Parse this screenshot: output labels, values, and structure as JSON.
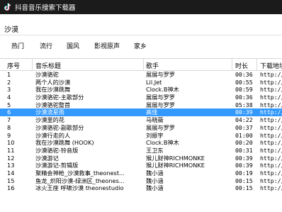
{
  "window": {
    "title": "抖音音乐搜索下载器"
  },
  "search": {
    "value": "沙漠"
  },
  "tabs": [
    "热门",
    "流行",
    "国风",
    "影视原声",
    "家乡"
  ],
  "table": {
    "headers": {
      "index": "序号",
      "title": "音乐标题",
      "artist": "歌手",
      "duration": "时长",
      "download": "下载地址"
    },
    "rows": [
      {
        "index": "1",
        "title": "沙漠骆驼",
        "artist": "展展与罗罗",
        "duration": "00:36",
        "download": "http://p"
      },
      {
        "index": "2",
        "title": "两个人的沙漠",
        "artist": "Lil.Jet",
        "duration": "00:55",
        "download": "http://p"
      },
      {
        "index": "3",
        "title": "我在沙漠跳舞",
        "artist": "Clock.B神木",
        "duration": "00:59",
        "download": "http://p"
      },
      {
        "index": "4",
        "title": "沙漠骆驼-主歌部分",
        "artist": "展展与罗罗",
        "duration": "00:36",
        "download": "http://p"
      },
      {
        "index": "5",
        "title": "沙漠骆驼整首",
        "artist": "展展与罗罗",
        "duration": "05:38",
        "download": "http://p"
      },
      {
        "index": "6",
        "title": "沙漠流星雨",
        "artist": "高佳",
        "duration": "00:39",
        "download": "http://p"
      },
      {
        "index": "7",
        "title": "沙漠里的花",
        "artist": "马晓薇",
        "duration": "04:22",
        "download": "http://p"
      },
      {
        "index": "8",
        "title": "沙漠骆驼-副歌部分",
        "artist": "展展与罗罗",
        "duration": "00:37",
        "download": "http://p"
      },
      {
        "index": "9",
        "title": "沙漠行走的人",
        "artist": "刘振宇",
        "duration": "01:00",
        "download": "http://p"
      },
      {
        "index": "10",
        "title": "我在沙漠跳舞 (HOOK)",
        "artist": "Clock.B神木",
        "duration": "00:20",
        "download": "http://p"
      },
      {
        "index": "11",
        "title": "沙漠骆驼-铃音版",
        "artist": "王卫东",
        "duration": "00:31",
        "download": "http://p"
      },
      {
        "index": "12",
        "title": "沙漠游记",
        "artist": "猴儿财神RICHMONKE",
        "duration": "00:39",
        "download": "http://p"
      },
      {
        "index": "13",
        "title": "沙漠游记-剪辑版",
        "artist": "猴儿财神RICHMONKE",
        "duration": "00:39",
        "download": "http://p"
      },
      {
        "index": "14",
        "title": "聚精会神枪_沙漠救事_theonest...",
        "artist": "魏小涵",
        "duration": "00:19",
        "download": "http://p"
      },
      {
        "index": "15",
        "title": "鱼龙_炽阳沙漠-绿洲区_theones...",
        "artist": "魏小涵",
        "duration": "00:15",
        "download": "http://p"
      },
      {
        "index": "16",
        "title": "冰火王座 呼啸沙漠 theonestudio",
        "artist": "魏小涵",
        "duration": "00:15",
        "download": "http://p"
      }
    ],
    "selected_index": 5
  }
}
